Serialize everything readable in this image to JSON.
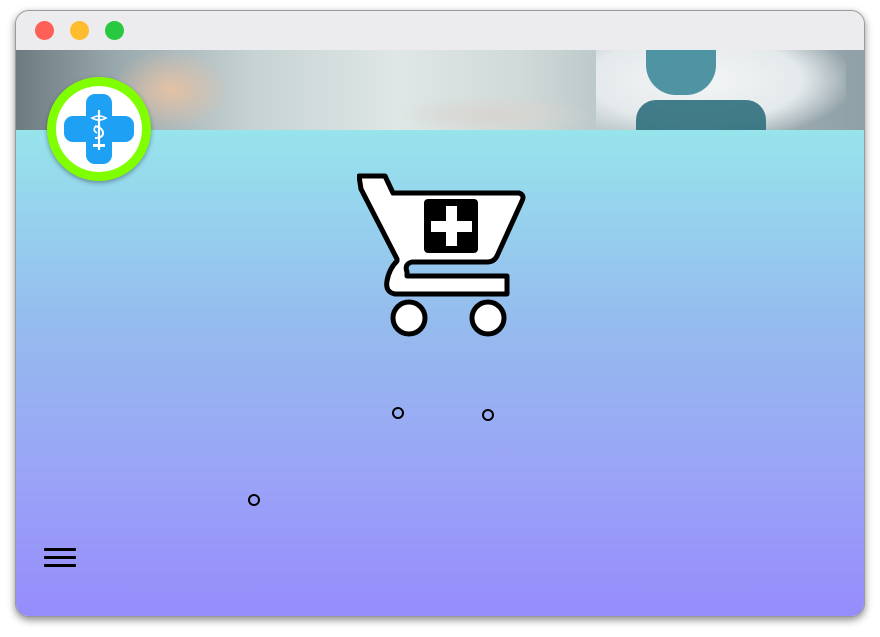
{
  "window": {
    "controls": [
      "close",
      "minimize",
      "maximize"
    ]
  },
  "banner": {
    "image": "pharmacy-photo"
  },
  "logo": {
    "icon": "medical-cross-caduceus-icon",
    "ring_color": "#7fff00",
    "cross_color": "#1ea0f5"
  },
  "hero": {
    "icon": "medical-cart-icon"
  },
  "decorations": {
    "dots": 3
  },
  "menu": {
    "icon": "hamburger-menu-icon"
  },
  "colors": {
    "gradient_top": "#97e4ec",
    "gradient_bottom": "#968cfc"
  }
}
